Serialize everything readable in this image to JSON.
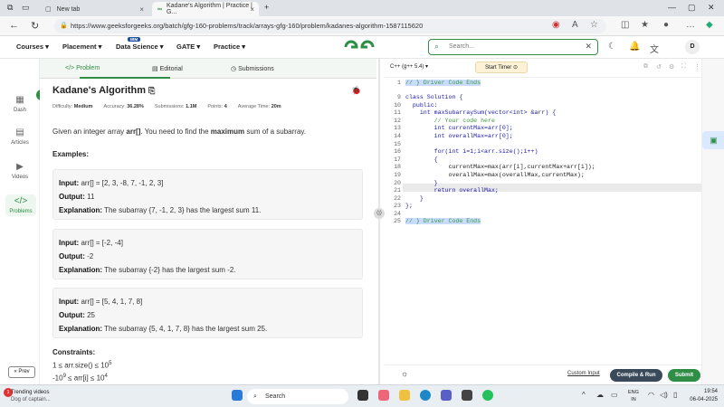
{
  "browser": {
    "tabs": [
      {
        "title": "New tab"
      },
      {
        "title": "Kadane's Algorithm | Practice | G..."
      }
    ],
    "url": "https://www.geeksforgeeks.org/batch/gfg-160-problems/track/arrays-gfg-160/problem/kadanes-algorithm-1587115620"
  },
  "site": {
    "menu": [
      "Courses ▾",
      "Placement ▾",
      "Data Science ▾",
      "GATE ▾",
      "Practice ▾"
    ],
    "badge": "IBM",
    "search_placeholder": "Search...",
    "avatar_letter": "D",
    "accent": "#2f8d46"
  },
  "rail": {
    "items": [
      {
        "label": "Dash",
        "icon": "dashboard-icon"
      },
      {
        "label": "Articles",
        "icon": "book-icon"
      },
      {
        "label": "Videos",
        "icon": "video-icon"
      },
      {
        "label": "Problems",
        "icon": "code-icon"
      }
    ],
    "prev": "« Prev"
  },
  "panel_tabs": [
    "Problem",
    "Editorial",
    "Submissions"
  ],
  "problem": {
    "title": "Kadane's Algorithm",
    "difficulty_label": "Difficulty:",
    "difficulty": "Medium",
    "accuracy_label": "Accuracy:",
    "accuracy": "36.28%",
    "submissions_label": "Submissions:",
    "submissions": "1.1M",
    "points_label": "Points:",
    "points": "4",
    "time_label": "Average Time:",
    "time": "20m",
    "statement_pre": "Given an integer array ",
    "statement_arr": "arr[]",
    "statement_mid": ". You need to find the ",
    "statement_bold": "maximum",
    "statement_post": " sum of a subarray.",
    "examples_heading": "Examples:",
    "input_label": "Input:",
    "output_label": "Output:",
    "explanation_label": "Explanation:",
    "examples": [
      {
        "input": "arr[] = [2, 3, -8, 7, -1, 2, 3]",
        "output": "11",
        "explanation": "The subarray {7, -1, 2, 3} has the largest sum 11."
      },
      {
        "input": "arr[] = [-2, -4]",
        "output": "-2",
        "explanation": "The subarray {-2} has the largest sum -2."
      },
      {
        "input": "arr[] = [5, 4, 1, 7, 8]",
        "output": "25",
        "explanation": "The subarray {5, 4, 1, 7, 8} has the largest sum 25."
      }
    ],
    "constraints_heading": "Constraints:",
    "c1_pre": "1 ≤ arr.size() ≤ 10",
    "c1_exp": "5",
    "c2_pre": "-10",
    "c2_exp": "9",
    "c2_mid": " ≤ arr[i] ≤ 10",
    "c2_exp2": "4"
  },
  "editor": {
    "language": "C++ (g++ 5.4) ▾",
    "timer": "Start Timer",
    "lines": [
      {
        "n": "1",
        "text": "// } Driver Code Ends",
        "kind": "hl"
      },
      {
        "n": "9",
        "text": "class Solution {",
        "kind": "code"
      },
      {
        "n": "10",
        "text": "  public:",
        "kind": "code"
      },
      {
        "n": "11",
        "text": "    int maxSubarraySum(vector<int> &arr) {",
        "kind": "code"
      },
      {
        "n": "12",
        "text": "        // Your code here",
        "kind": "cmt"
      },
      {
        "n": "13",
        "text": "        int currentMax=arr[0];",
        "kind": "code"
      },
      {
        "n": "14",
        "text": "        int overallMax=arr[0];",
        "kind": "code"
      },
      {
        "n": "15",
        "text": "",
        "kind": "code"
      },
      {
        "n": "16",
        "text": "        for(int i=1;i<arr.size();i++)",
        "kind": "code"
      },
      {
        "n": "17",
        "text": "        {",
        "kind": "code"
      },
      {
        "n": "18",
        "text": "            currentMax=max(arr[i],currentMax+arr[i]);",
        "kind": "plain"
      },
      {
        "n": "19",
        "text": "            overallMax=max(overallMax,currentMax);",
        "kind": "plain"
      },
      {
        "n": "20",
        "text": "        }",
        "kind": "code"
      },
      {
        "n": "21",
        "text": "        return overallMax;",
        "kind": "code"
      },
      {
        "n": "22",
        "text": "    }",
        "kind": "code"
      },
      {
        "n": "23",
        "text": "};",
        "kind": "code"
      },
      {
        "n": "24",
        "text": "",
        "kind": "code"
      },
      {
        "n": "25",
        "text": "// } Driver Code Ends",
        "kind": "hl"
      }
    ],
    "custom_input": "Custom Input",
    "compile": "Compile & Run",
    "submit": "Submit"
  },
  "taskbar": {
    "news_count": "1",
    "news_title": "Trending videos",
    "news_sub": "Dog of captain...",
    "search": "Search",
    "lang_1": "ENG",
    "lang_2": "IN",
    "time": "19:54",
    "date": "06-04-2025"
  }
}
